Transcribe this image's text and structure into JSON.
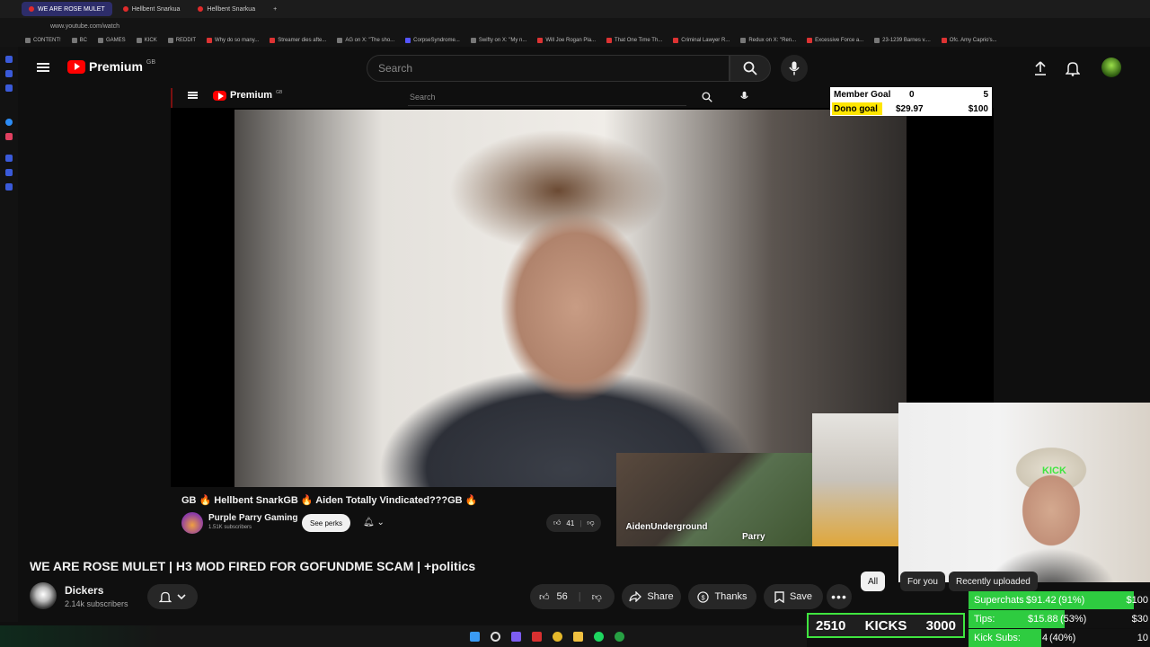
{
  "browser": {
    "tabs": [
      {
        "label": "WE ARE ROSE MULET",
        "active": true
      },
      {
        "label": "Hellbent Snarkua",
        "active": false
      },
      {
        "label": "Hellbent Snarkua",
        "active": false
      }
    ],
    "url": "www.youtube.com/watch",
    "bookmarks": [
      "CONTENT!",
      "BC",
      "GAMES",
      "KICK",
      "REDDIT",
      "Why do so many...",
      "Streamer dies afte...",
      "AG on X: \"The sho...",
      "CorpseSyndrome...",
      "Swifty on X: \"My n...",
      "Will Joe Rogan Pla...",
      "That One Time Th...",
      "Criminal Lawyer R...",
      "Redux on X: \"Ren...",
      "Excessive Force a...",
      "23-1239 Barnes v....",
      "Ofc. Amy Caprio's..."
    ]
  },
  "header": {
    "logo": "Premium",
    "region": "GB",
    "search_placeholder": "Search"
  },
  "inner_player": {
    "logo": "Premium",
    "region": "GB",
    "search_placeholder": "Search",
    "video_title": "GB 🔥 Hellbent SnarkGB 🔥 Aiden Totally Vindicated???GB 🔥",
    "channel": "Purple Parry Gaming",
    "subscribers": "1.51K subscribers",
    "perks_label": "See perks",
    "likes": "41",
    "cam1_label": "AidenUnderground",
    "cam2_label": "Parry"
  },
  "goals": {
    "member_label": "Member Goal",
    "member_current": "0",
    "member_target": "5",
    "dono_label": "Dono goal",
    "dono_current": "$29.97",
    "dono_target": "$100"
  },
  "video": {
    "title": "WE ARE ROSE MULET | H3 MOD FIRED FOR GOFUNDME SCAM | +politics",
    "channel": "Dickers",
    "subscribers": "2.14k subscribers",
    "likes": "56",
    "share_label": "Share",
    "thanks_label": "Thanks",
    "save_label": "Save"
  },
  "chips": {
    "all": "All",
    "for_you": "For you",
    "recent": "Recently uploaded"
  },
  "kicks": {
    "current": "2510",
    "label": "KICKS",
    "target": "3000"
  },
  "stats": {
    "superchats_label": "Superchats",
    "superchats_value": "$91.42",
    "superchats_pct": "(91%)",
    "superchats_target": "$100",
    "superchats_fill": 0.91,
    "tips_label": "Tips:",
    "tips_value": "$15.88",
    "tips_pct": "(53%)",
    "tips_target": "$30",
    "tips_fill": 0.53,
    "subs_label": "Kick Subs:",
    "subs_value": "4",
    "subs_pct": "(40%)",
    "subs_target": "10",
    "subs_fill": 0.4
  },
  "colors": {
    "youtube_red": "#ff0000",
    "kick_green": "#2ecc40",
    "goal_yellow": "#ffe600"
  }
}
